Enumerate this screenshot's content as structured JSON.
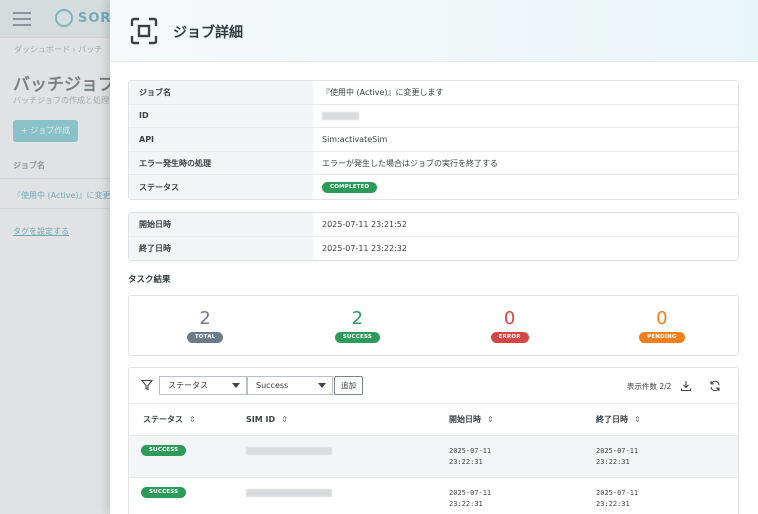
{
  "background": {
    "logo_text": "SORA",
    "breadcrumb": "ダッシュボード  ›  バッチ",
    "title": "バッチジョブ",
    "subtitle": "バッチジョブの作成と処理",
    "create_button": "+ ジョブ作成",
    "column_header": "ジョブ名",
    "row_job": "『使用中 (Active)』に変更します",
    "tag_link": "タグを設定する"
  },
  "drawer": {
    "title": "ジョブ詳細",
    "details": [
      {
        "key": "ジョブ名",
        "value": "『使用中 (Active)』に変更します"
      },
      {
        "key": "ID",
        "value": ""
      },
      {
        "key": "API",
        "value": "Sim:activateSim"
      },
      {
        "key": "エラー発生時の処理",
        "value": "エラーが発生した場合はジョブの実行を終了する"
      },
      {
        "key": "ステータス",
        "value": "COMPLETED"
      }
    ],
    "times": [
      {
        "key": "開始日時",
        "value": "2025-07-11 23:21:52"
      },
      {
        "key": "終了日時",
        "value": "2025-07-11 23:22:32"
      }
    ],
    "task_results_title": "タスク結果",
    "summary": [
      {
        "count": "2",
        "label": "TOTAL",
        "color": "#6b7b8a"
      },
      {
        "count": "2",
        "label": "SUCCESS",
        "color": "#2e9a5a"
      },
      {
        "count": "0",
        "label": "ERROR",
        "color": "#d64545"
      },
      {
        "count": "0",
        "label": "PENDING",
        "color": "#f07f1c"
      }
    ],
    "filter": {
      "field_select": "ステータス",
      "value_select": "Success",
      "add_button": "追加",
      "count_label": "表示件数 2/2"
    },
    "table": {
      "headers": [
        "ステータス",
        "SIM ID",
        "開始日時",
        "終了日時"
      ],
      "rows": [
        {
          "status": "SUCCESS",
          "start_date": "2025-07-11",
          "start_time": "23:22:31",
          "end_date": "2025-07-11",
          "end_time": "23:22:31"
        },
        {
          "status": "SUCCESS",
          "start_date": "2025-07-11",
          "start_time": "23:22:31",
          "end_date": "2025-07-11",
          "end_time": "23:22:31"
        }
      ]
    }
  }
}
